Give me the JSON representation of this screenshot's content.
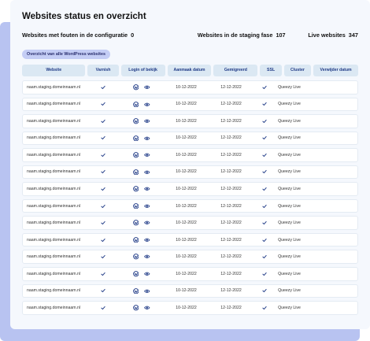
{
  "title": "Websites status en overzicht",
  "stats": {
    "errors_label": "Websites met fouten in de configuratie",
    "errors_count": "0",
    "staging_label": "Websites in de staging fase",
    "staging_count": "107",
    "live_label": "Live websites",
    "live_count": "347"
  },
  "filter_pill": "Overzicht van alle WordPress websites",
  "columns": [
    "Website",
    "Varnish",
    "Login of bekijk",
    "Aanmaak datum",
    "Gemigreerd",
    "SSL",
    "Cluster",
    "Verwijder datum"
  ],
  "rows": [
    {
      "website": "naam.staging.domeinnaam.nl",
      "added": "10-12-2022",
      "migrated": "12-12-2022",
      "cluster": "Queezy Live"
    },
    {
      "website": "naam.staging.domeinnaam.nl",
      "added": "10-12-2022",
      "migrated": "12-12-2022",
      "cluster": "Queezy Live"
    },
    {
      "website": "naam.staging.domeinnaam.nl",
      "added": "10-12-2022",
      "migrated": "12-12-2022",
      "cluster": "Queezy Live"
    },
    {
      "website": "naam.staging.domeinnaam.nl",
      "added": "10-12-2022",
      "migrated": "12-12-2022",
      "cluster": "Queezy Live"
    },
    {
      "website": "naam.staging.domeinnaam.nl",
      "added": "10-12-2022",
      "migrated": "12-12-2022",
      "cluster": "Queezy Live"
    },
    {
      "website": "naam.staging.domeinnaam.nl",
      "added": "10-12-2022",
      "migrated": "12-12-2022",
      "cluster": "Queezy Live"
    },
    {
      "website": "naam.staging.domeinnaam.nl",
      "added": "10-12-2022",
      "migrated": "12-12-2022",
      "cluster": "Queezy Live"
    },
    {
      "website": "naam.staging.domeinnaam.nl",
      "added": "10-12-2022",
      "migrated": "12-12-2022",
      "cluster": "Queezy Live"
    },
    {
      "website": "naam.staging.domeinnaam.nl",
      "added": "10-12-2022",
      "migrated": "12-12-2022",
      "cluster": "Queezy Live"
    },
    {
      "website": "naam.staging.domeinnaam.nl",
      "added": "10-12-2022",
      "migrated": "12-12-2022",
      "cluster": "Queezy Live"
    },
    {
      "website": "naam.staging.domeinnaam.nl",
      "added": "10-12-2022",
      "migrated": "12-12-2022",
      "cluster": "Queezy Live"
    },
    {
      "website": "naam.staging.domeinnaam.nl",
      "added": "10-12-2022",
      "migrated": "12-12-2022",
      "cluster": "Queezy Live"
    },
    {
      "website": "naam.staging.domeinnaam.nl",
      "added": "10-12-2022",
      "migrated": "12-12-2022",
      "cluster": "Queezy Live"
    },
    {
      "website": "naam.staging.domeinnaam.nl",
      "added": "10-12-2022",
      "migrated": "12-12-2022",
      "cluster": "Queezy Live"
    }
  ],
  "icons": {
    "check": "check-icon",
    "login": "wordpress-icon",
    "view": "eye-icon"
  },
  "colors": {
    "accent": "#1f3a86",
    "backdrop": "#b8c3f1",
    "pill": "#c4cdf5",
    "header_cell": "#dbe8f3"
  }
}
